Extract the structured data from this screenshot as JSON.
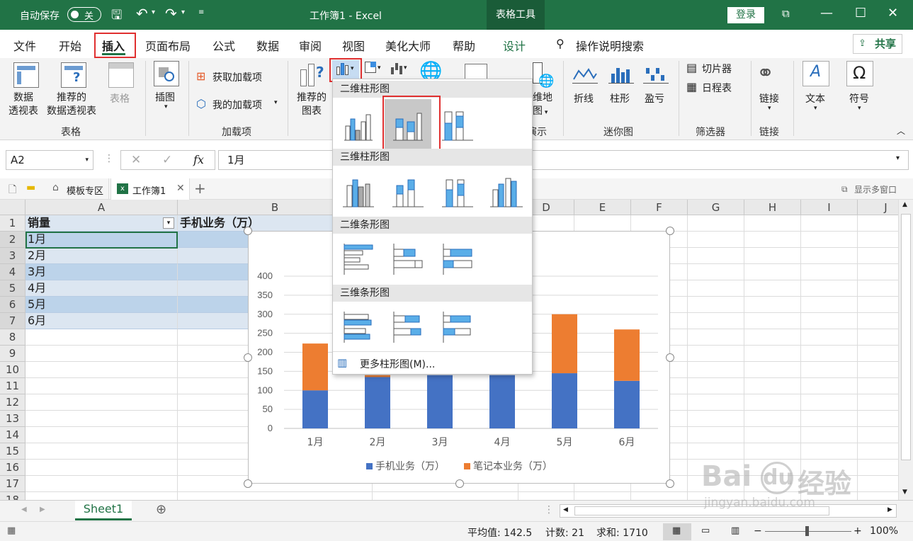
{
  "title_bar": {
    "autosave_label": "自动保存",
    "autosave_state": "关",
    "doc_title": "工作簿1  -  Excel",
    "context_tab": "表格工具",
    "login": "登录"
  },
  "tabs": [
    "文件",
    "开始",
    "插入",
    "页面布局",
    "公式",
    "数据",
    "审阅",
    "视图",
    "美化大师",
    "帮助",
    "设计"
  ],
  "search_label": "操作说明搜索",
  "share_label": "共享",
  "ribbon": {
    "pivot": [
      "数据",
      "透视表"
    ],
    "rec_pivot": [
      "推荐的",
      "数据透视表"
    ],
    "table": "表格",
    "illustration": "插图",
    "get_addins": "获取加载项",
    "my_addins": "我的加载项",
    "rec_charts": [
      "推荐的",
      "图表"
    ],
    "map": [
      "维地",
      "图"
    ],
    "demo_partial": "演示",
    "line": "折线",
    "column": "柱形",
    "winloss": "盈亏",
    "slicer": "切片器",
    "timeline": "日程表",
    "link": "链接",
    "text": "文本",
    "symbol": "符号",
    "omega": "Ω",
    "groups": {
      "tables": "表格",
      "addins": "加载项",
      "sparklines": "迷你图",
      "filters": "筛选器",
      "links": "链接"
    }
  },
  "formula_bar": {
    "name_box": "A2",
    "fx": "fx",
    "value": "1月"
  },
  "file_tabs": {
    "template": "模板专区",
    "workbook": "工作簿1",
    "multi_window": "显示多窗口"
  },
  "columns": [
    "A",
    "B",
    "C",
    "D",
    "E",
    "F",
    "G",
    "H",
    "I",
    "J"
  ],
  "rows": [
    "1",
    "2",
    "3",
    "4",
    "5",
    "6",
    "7",
    "8",
    "9",
    "10",
    "11",
    "12",
    "13",
    "14",
    "15",
    "16",
    "17",
    "18"
  ],
  "table": {
    "header_a": "销量",
    "header_b": "手机业务（万）",
    "months": [
      "1月",
      "2月",
      "3月",
      "4月",
      "5月",
      "6月"
    ]
  },
  "chart_data": {
    "type": "bar",
    "stacked": true,
    "categories": [
      "1月",
      "2月",
      "3月",
      "4月",
      "5月",
      "6月"
    ],
    "series": [
      {
        "name": "手机业务（万）",
        "color": "#4472c4",
        "values": [
          100,
          135,
          140,
          140,
          145,
          125
        ]
      },
      {
        "name": "笔记本业务（万）",
        "color": "#ed7d31",
        "values": [
          123,
          5,
          0,
          0,
          155,
          135
        ]
      }
    ],
    "ylim": [
      0,
      400
    ],
    "yticks": [
      "0",
      "50",
      "100",
      "150",
      "200",
      "250",
      "300",
      "350",
      "400"
    ],
    "grid": true,
    "legend": "bottom"
  },
  "dropdown": {
    "sections": [
      "二维柱形图",
      "三维柱形图",
      "二维条形图",
      "三维条形图"
    ],
    "more": "更多柱形图(M)..."
  },
  "sheet_tab": "Sheet1",
  "status": {
    "avg": "平均值: 142.5",
    "count": "计数: 21",
    "sum": "求和: 1710",
    "zoom": "100%"
  },
  "watermark": [
    "Bai",
    "du",
    "经验",
    "jingyan.baidu.com"
  ]
}
